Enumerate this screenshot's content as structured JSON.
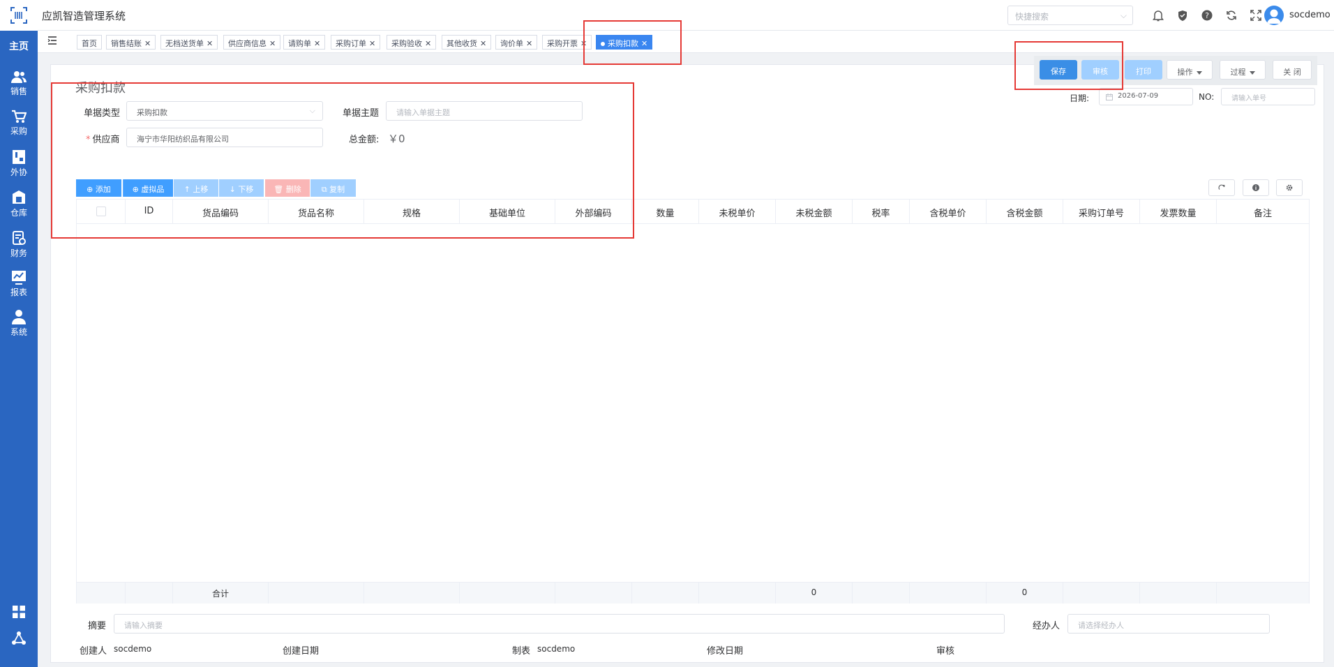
{
  "app": {
    "title": "应凯智造管理系统",
    "username": "socdemo"
  },
  "header": {
    "search_placeholder": "快捷搜索"
  },
  "sidebar": {
    "home": "主页",
    "items": [
      {
        "label": "销售",
        "icon": "users-icon"
      },
      {
        "label": "采购",
        "icon": "cart-icon"
      },
      {
        "label": "外协",
        "icon": "outsourcing-icon"
      },
      {
        "label": "仓库",
        "icon": "warehouse-icon"
      },
      {
        "label": "财务",
        "icon": "finance-icon"
      },
      {
        "label": "报表",
        "icon": "report-icon"
      },
      {
        "label": "系统",
        "icon": "user-icon"
      }
    ]
  },
  "tabs": [
    {
      "label": "首页",
      "closable": false
    },
    {
      "label": "销售结账",
      "closable": true
    },
    {
      "label": "无档送货单",
      "closable": true
    },
    {
      "label": "供应商信息",
      "closable": true
    },
    {
      "label": "请购单",
      "closable": true
    },
    {
      "label": "采购订单",
      "closable": true
    },
    {
      "label": "采购验收",
      "closable": true
    },
    {
      "label": "其他收货",
      "closable": true
    },
    {
      "label": "询价单",
      "closable": true
    },
    {
      "label": "采购开票",
      "closable": true
    },
    {
      "label": "采购扣款",
      "closable": true,
      "active": true
    }
  ],
  "actions": {
    "save": "保存",
    "audit": "审核",
    "print": "打印",
    "operate": "操作",
    "process": "过程",
    "close": "关 闭"
  },
  "form": {
    "title": "采购扣款",
    "doc_type_label": "单据类型",
    "doc_type_value": "采购扣款",
    "subject_label": "单据主题",
    "subject_placeholder": "请输入单据主题",
    "supplier_label": "供应商",
    "supplier_value": "海宁市华阳纺织品有限公司",
    "total_label": "总金额:",
    "total_value": "￥0",
    "date_label": "日期:",
    "date_value": "2026-07-09",
    "no_label": "NO:",
    "no_placeholder": "请输入单号"
  },
  "toolbar": {
    "add": "添加",
    "virtual": "虚拟品",
    "up": "上移",
    "down": "下移",
    "delete": "删除",
    "copy": "复制"
  },
  "grid": {
    "columns": [
      "ID",
      "货品编码",
      "货品名称",
      "规格",
      "基础单位",
      "外部编码",
      "数量",
      "未税单价",
      "未税金额",
      "税率",
      "含税单价",
      "含税金额",
      "采购订单号",
      "发票数量",
      "备注"
    ],
    "footer": {
      "label": "合计",
      "untaxed_amount": "0",
      "taxed_amount": "0"
    }
  },
  "bottom": {
    "summary_label": "摘要",
    "summary_placeholder": "请输入摘要",
    "handler_label": "经办人",
    "handler_placeholder": "请选择经办人",
    "creator_label": "创建人",
    "creator_value": "socdemo",
    "created_date_label": "创建日期",
    "maker_label": "制表",
    "maker_value": "socdemo",
    "modified_date_label": "修改日期",
    "audit_label": "审核"
  },
  "colors": {
    "sidebar": "#2a66c1",
    "primary": "#409eff",
    "highlight": "#e53935"
  }
}
